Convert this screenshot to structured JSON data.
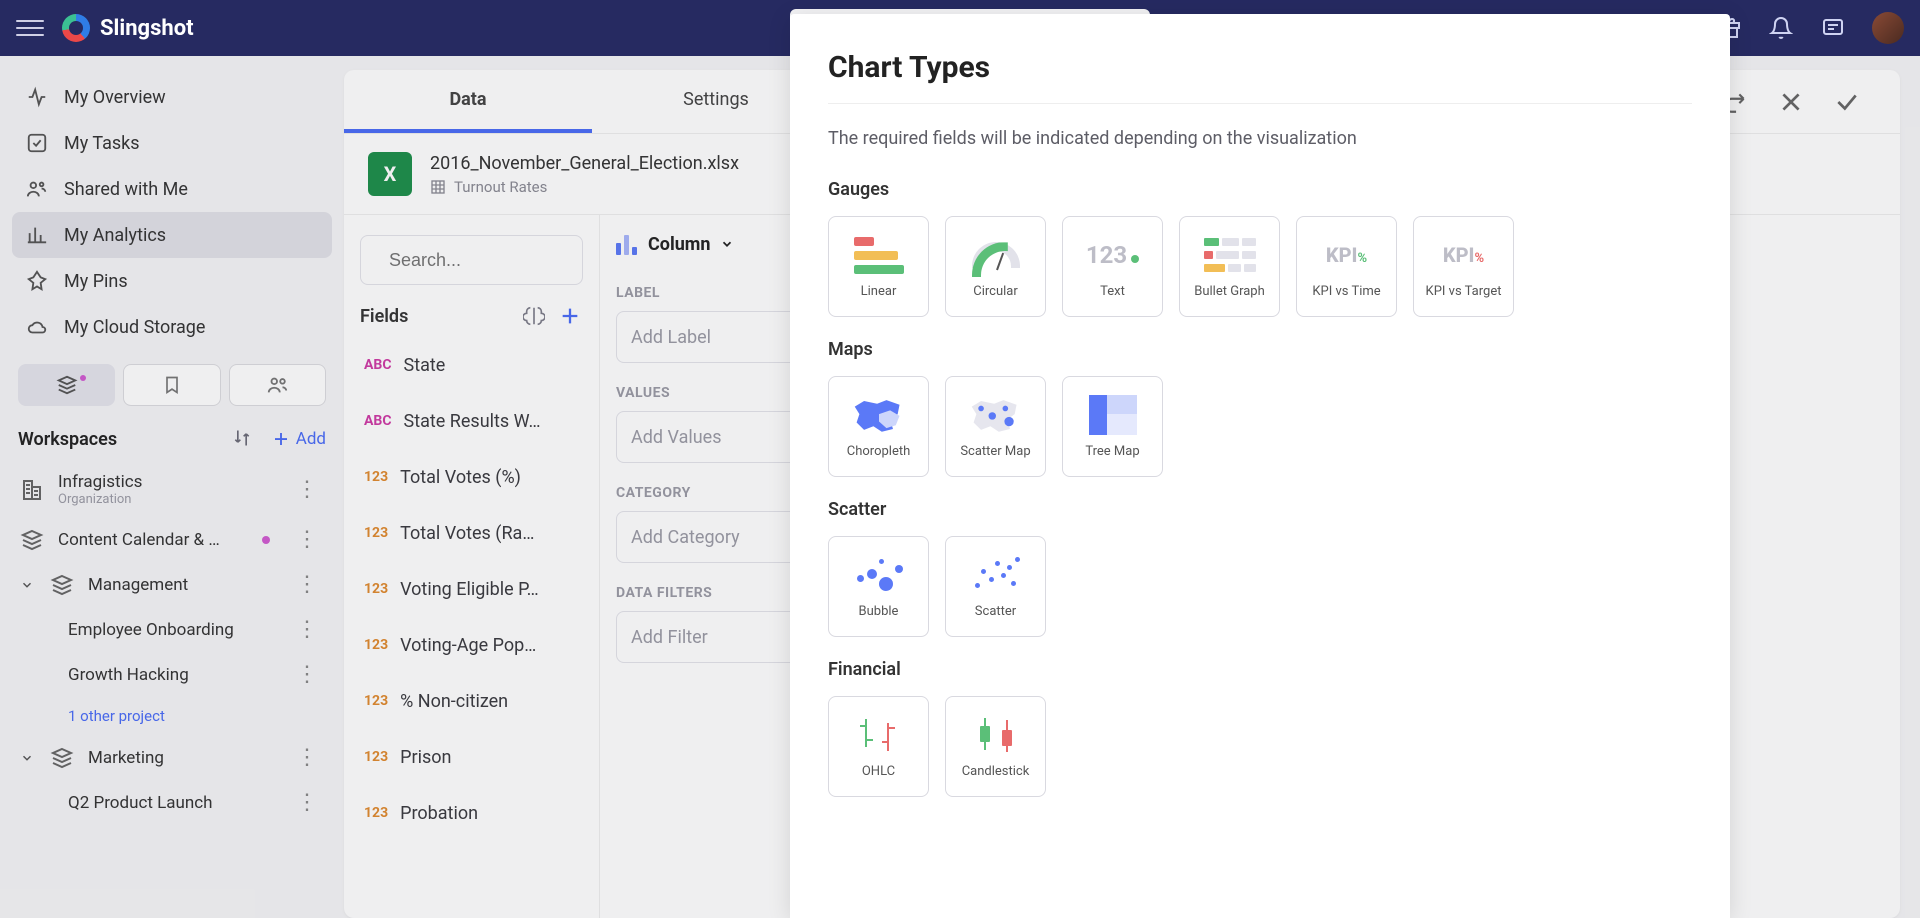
{
  "app": {
    "name": "Slingshot"
  },
  "nav": {
    "items": [
      {
        "label": "My Overview"
      },
      {
        "label": "My Tasks"
      },
      {
        "label": "Shared with Me"
      },
      {
        "label": "My Analytics"
      },
      {
        "label": "My Pins"
      },
      {
        "label": "My Cloud Storage"
      }
    ]
  },
  "workspaces": {
    "title": "Workspaces",
    "add_label": "Add",
    "items": [
      {
        "name": "Infragistics",
        "sub": "Organization"
      },
      {
        "name": "Content Calendar & …",
        "dot": true
      },
      {
        "name": "Management",
        "expandable": true
      },
      {
        "name": "Employee Onboarding",
        "child": true
      },
      {
        "name": "Growth Hacking",
        "child": true
      },
      {
        "link": "1 other project"
      },
      {
        "name": "Marketing",
        "expandable": true
      },
      {
        "name": "Q2 Product Launch",
        "child": true
      }
    ]
  },
  "panel": {
    "tabs": {
      "data": "Data",
      "settings": "Settings"
    },
    "file": {
      "name": "2016_November_General_Election.xlsx",
      "sheet": "Turnout Rates",
      "badge": "X"
    },
    "search_placeholder": "Search...",
    "viz_selector": "Column",
    "fields_title": "Fields",
    "fields": [
      {
        "type": "abc",
        "name": "State"
      },
      {
        "type": "abc",
        "name": "State Results W…"
      },
      {
        "type": "123",
        "name": "Total Votes (%)"
      },
      {
        "type": "123",
        "name": "Total Votes (Ra…"
      },
      {
        "type": "123",
        "name": "Voting Eligible P…"
      },
      {
        "type": "123",
        "name": "Voting-Age Pop…"
      },
      {
        "type": "123",
        "name": "% Non-citizen"
      },
      {
        "type": "123",
        "name": "Prison"
      },
      {
        "type": "123",
        "name": "Probation"
      }
    ],
    "sections": {
      "label": {
        "title": "LABEL",
        "placeholder": "Add Label"
      },
      "values": {
        "title": "VALUES",
        "placeholder": "Add Values"
      },
      "category": {
        "title": "CATEGORY",
        "placeholder": "Add Category"
      },
      "datafilters": {
        "title": "DATA FILTERS",
        "placeholder": "Add Filter"
      }
    }
  },
  "popup": {
    "title": "Chart Types",
    "subtitle": "The required fields will be indicated depending on the visualization",
    "groups": [
      {
        "name": "Gauges",
        "tiles": [
          "Linear",
          "Circular",
          "Text",
          "Bullet Graph",
          "KPI vs Time",
          "KPI vs Target"
        ]
      },
      {
        "name": "Maps",
        "tiles": [
          "Choropleth",
          "Scatter Map",
          "Tree Map"
        ]
      },
      {
        "name": "Scatter",
        "tiles": [
          "Bubble",
          "Scatter"
        ]
      },
      {
        "name": "Financial",
        "tiles": [
          "OHLC",
          "Candlestick"
        ]
      }
    ]
  }
}
